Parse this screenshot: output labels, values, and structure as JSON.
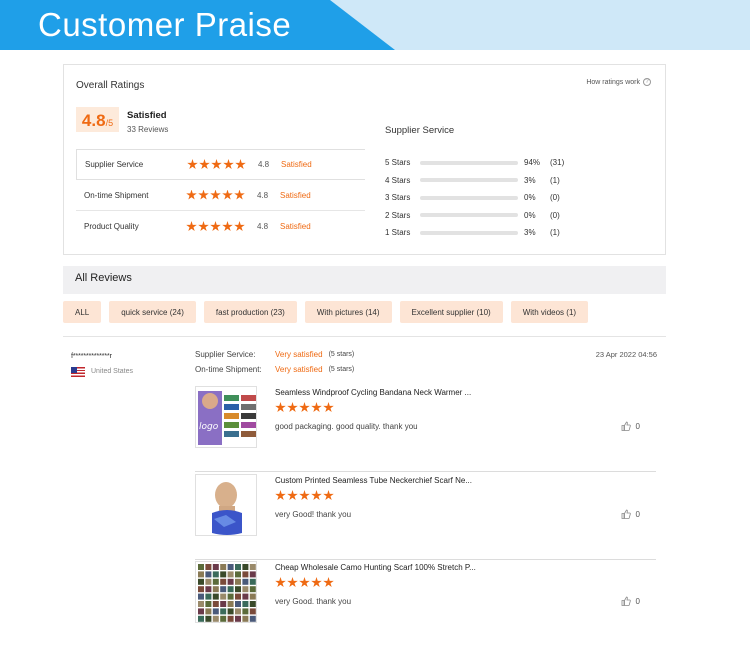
{
  "banner": {
    "title": "Customer Praise"
  },
  "overall": {
    "heading": "Overall Ratings",
    "how_link": "How ratings work",
    "score": "4.8",
    "score_suffix": "/5",
    "score_word": "Satisfied",
    "review_count": "33 Reviews",
    "categories": [
      {
        "name": "Supplier Service",
        "score": "4.8",
        "status": "Satisfied",
        "stars": 5
      },
      {
        "name": "On-time Shipment",
        "score": "4.8",
        "status": "Satisfied",
        "stars": 5
      },
      {
        "name": "Product Quality",
        "score": "4.8",
        "status": "Satisfied",
        "stars": 5
      }
    ]
  },
  "supplier_breakdown": {
    "title": "Supplier Service",
    "rows": [
      {
        "label": "5 Stars",
        "percent": "94%",
        "count": "(31)",
        "fraction": 0.94
      },
      {
        "label": "4 Stars",
        "percent": "3%",
        "count": "(1)",
        "fraction": 0.03
      },
      {
        "label": "3 Stars",
        "percent": "0%",
        "count": "(0)",
        "fraction": 0.0
      },
      {
        "label": "2 Stars",
        "percent": "0%",
        "count": "(0)",
        "fraction": 0.0
      },
      {
        "label": "1 Stars",
        "percent": "3%",
        "count": "(1)",
        "fraction": 0.03
      }
    ]
  },
  "all_reviews": {
    "title": "All Reviews"
  },
  "filters": [
    "ALL",
    "quick service (24)",
    "fast production (23)",
    "With pictures (14)",
    "Excellent supplier (10)",
    "With videos (1)"
  ],
  "review": {
    "reviewer": "f**************r",
    "country": "United States",
    "date": "23 Apr 2022 04:56",
    "supplier_service_label": "Supplier Service:",
    "supplier_service_value": "Very satisfied",
    "supplier_service_stars": "(5 stars)",
    "shipment_label": "On-time Shipment:",
    "shipment_value": "Very satisfied",
    "shipment_stars": "(5 stars)",
    "products": [
      {
        "title": "Seamless Windproof Cycling Bandana Neck Warmer ...",
        "comment": "good packaging. good quality. thank you",
        "likes": "0",
        "stars": 5,
        "image": "bandana-collage"
      },
      {
        "title": "Custom Printed Seamless Tube Neckerchief Scarf Ne...",
        "comment": "very Good! thank you",
        "likes": "0",
        "stars": 5,
        "image": "mannequin-scarf"
      },
      {
        "title": "Cheap Wholesale Camo Hunting Scarf 100% Stretch P...",
        "comment": "very Good. thank you",
        "likes": "0",
        "stars": 5,
        "image": "camo-grid"
      }
    ]
  },
  "colors": {
    "accent": "#ef6a13",
    "banner_blue": "#1f9fe8",
    "badge_bg": "#fdeadb",
    "filter_bg": "#fde5d5"
  }
}
